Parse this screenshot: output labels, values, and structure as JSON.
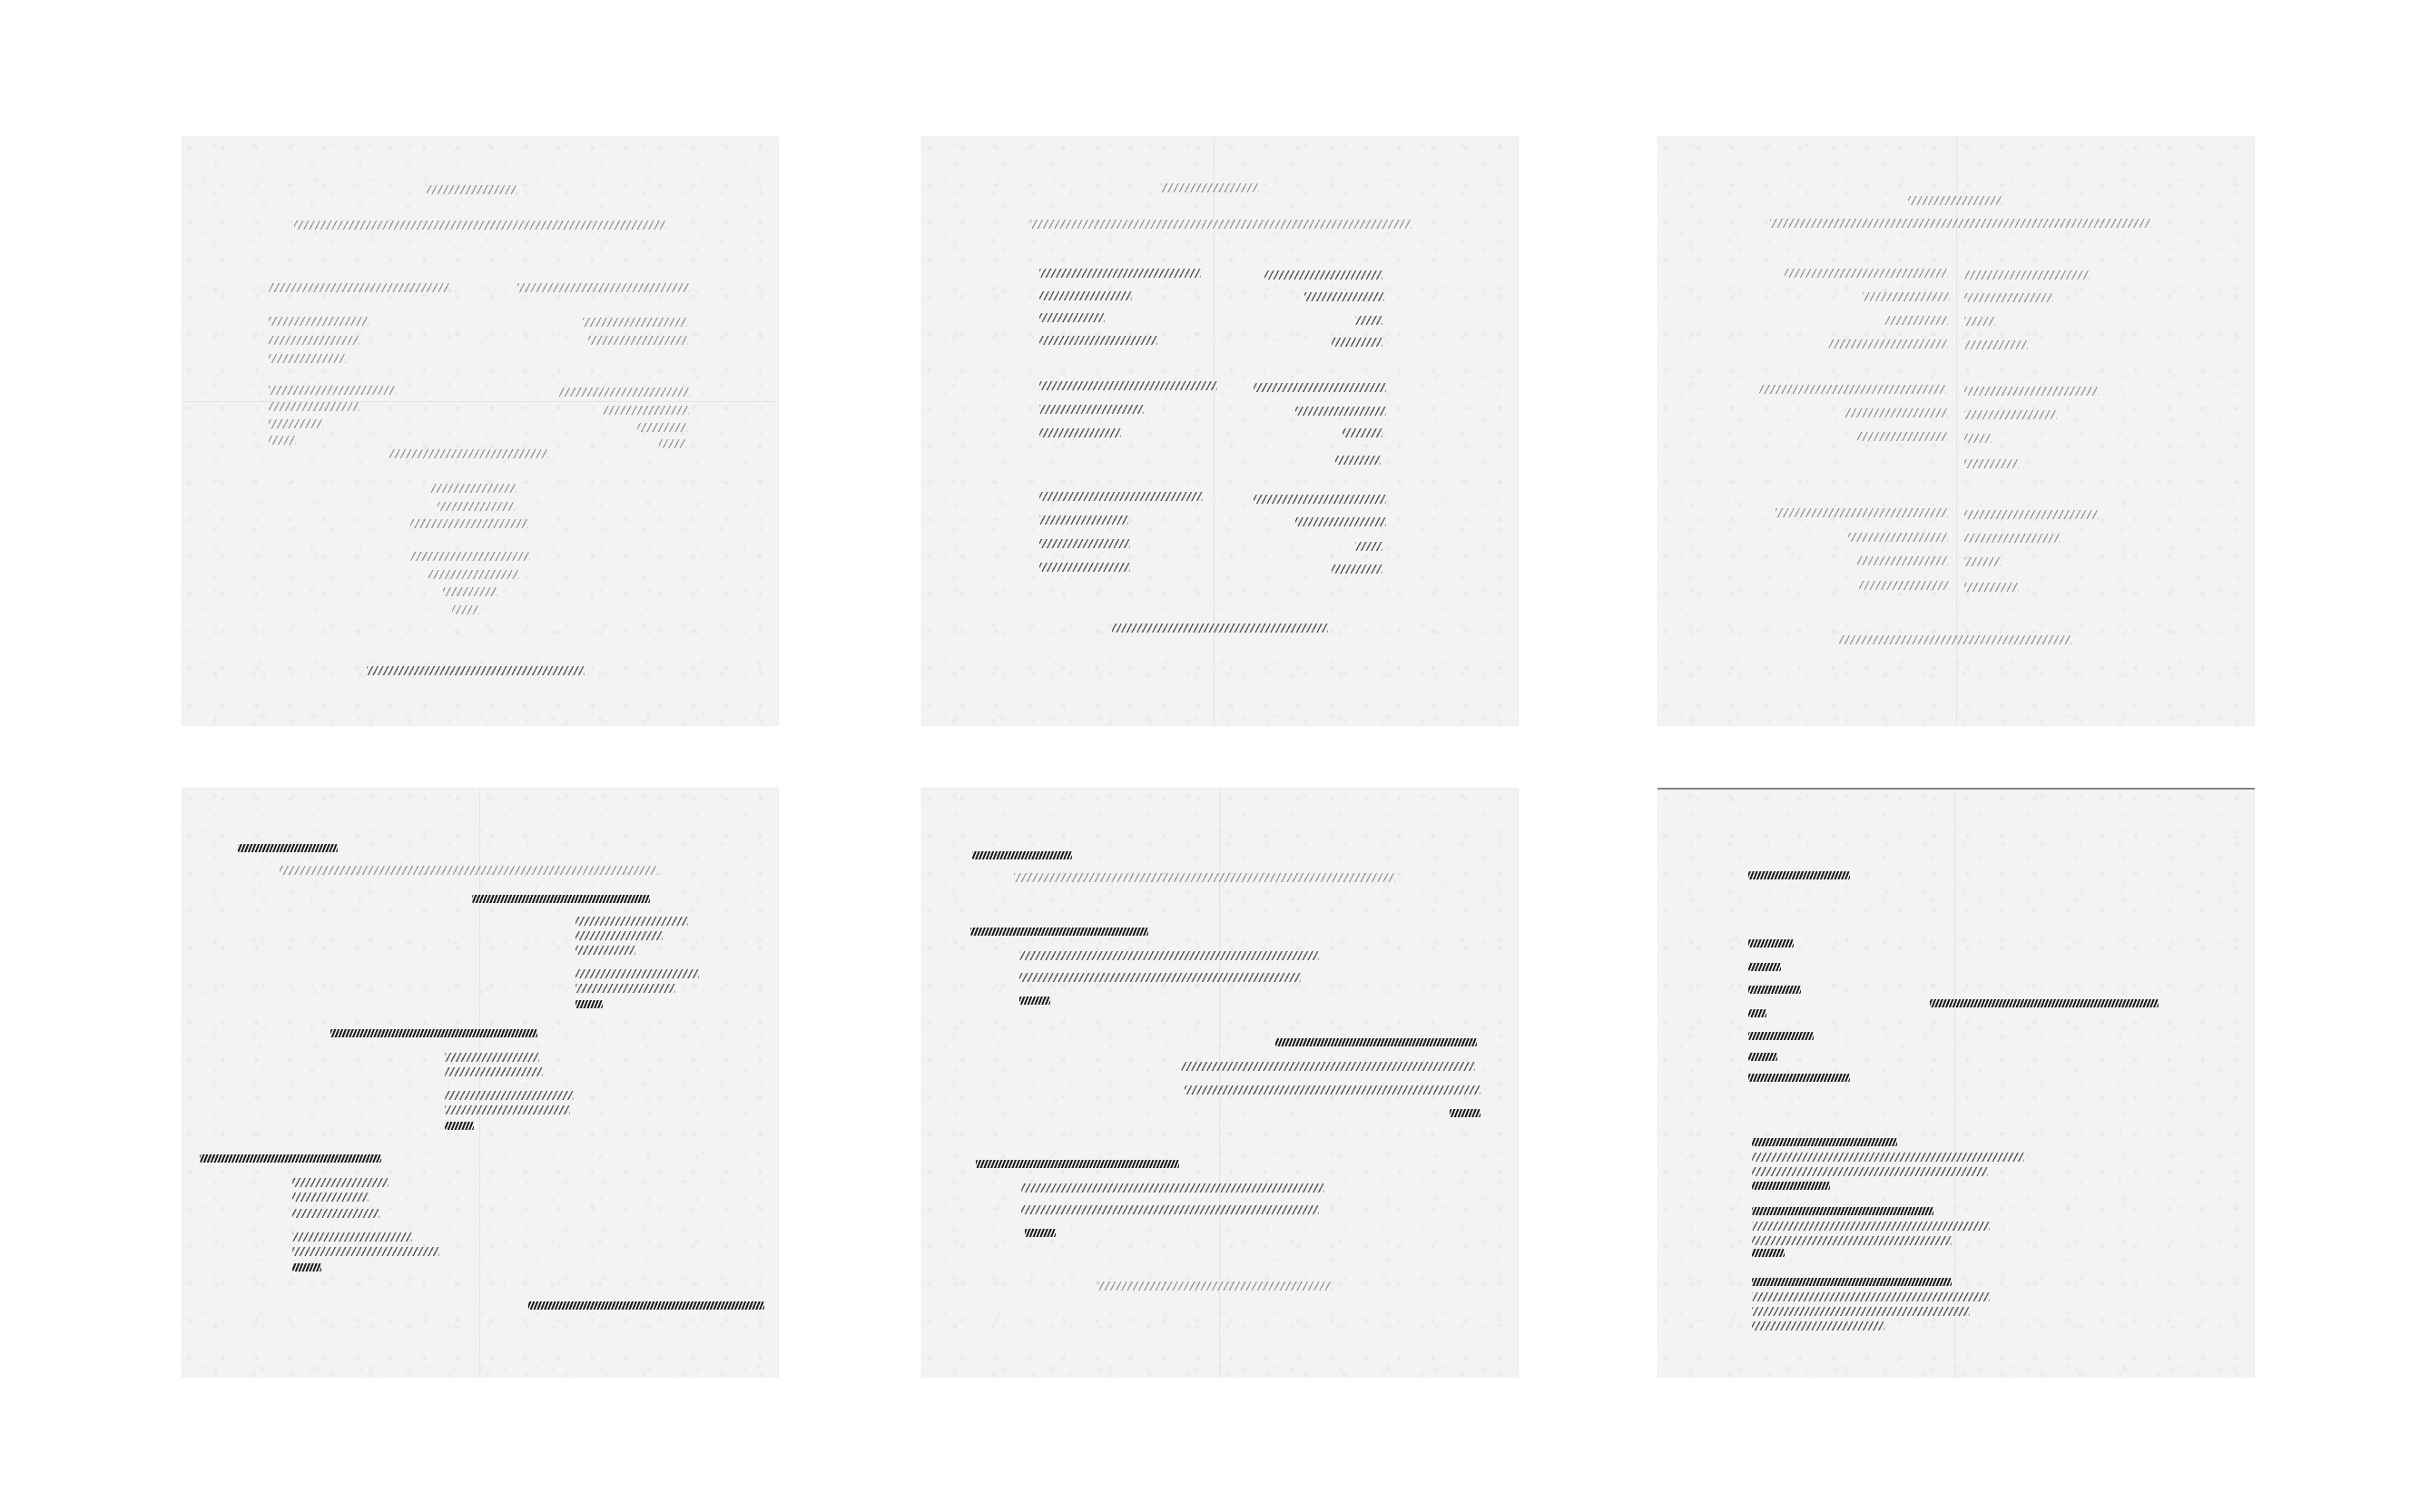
{
  "gallery": {
    "sheets": [
      {
        "id": "sheet-1"
      },
      {
        "id": "sheet-2"
      },
      {
        "id": "sheet-3"
      },
      {
        "id": "sheet-4"
      },
      {
        "id": "sheet-5"
      },
      {
        "id": "sheet-6"
      }
    ]
  },
  "colors": {
    "background": "#ffffff",
    "paper": "#f3f3f3",
    "ink": "#191919"
  }
}
